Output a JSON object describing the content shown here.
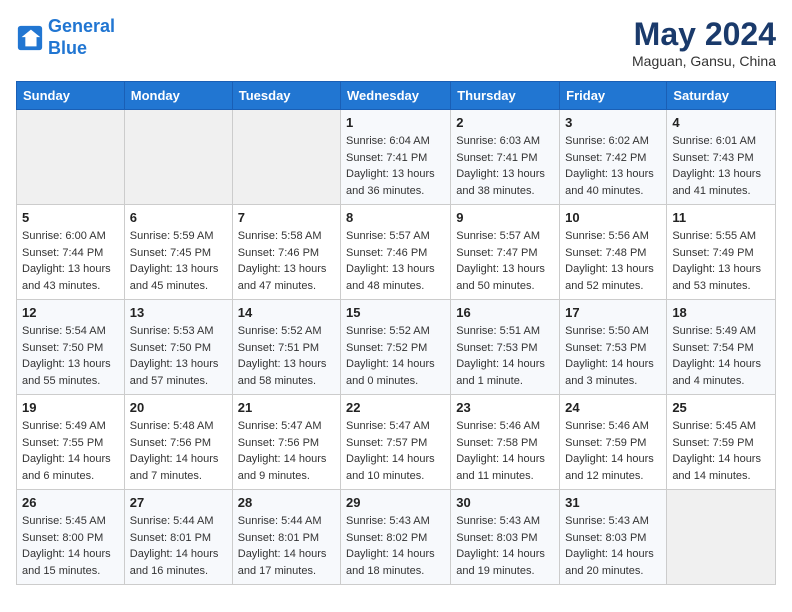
{
  "header": {
    "logo_line1": "General",
    "logo_line2": "Blue",
    "month": "May 2024",
    "location": "Maguan, Gansu, China"
  },
  "weekdays": [
    "Sunday",
    "Monday",
    "Tuesday",
    "Wednesday",
    "Thursday",
    "Friday",
    "Saturday"
  ],
  "weeks": [
    [
      {
        "day": "",
        "info": ""
      },
      {
        "day": "",
        "info": ""
      },
      {
        "day": "",
        "info": ""
      },
      {
        "day": "1",
        "info": "Sunrise: 6:04 AM\nSunset: 7:41 PM\nDaylight: 13 hours and 36 minutes."
      },
      {
        "day": "2",
        "info": "Sunrise: 6:03 AM\nSunset: 7:41 PM\nDaylight: 13 hours and 38 minutes."
      },
      {
        "day": "3",
        "info": "Sunrise: 6:02 AM\nSunset: 7:42 PM\nDaylight: 13 hours and 40 minutes."
      },
      {
        "day": "4",
        "info": "Sunrise: 6:01 AM\nSunset: 7:43 PM\nDaylight: 13 hours and 41 minutes."
      }
    ],
    [
      {
        "day": "5",
        "info": "Sunrise: 6:00 AM\nSunset: 7:44 PM\nDaylight: 13 hours and 43 minutes."
      },
      {
        "day": "6",
        "info": "Sunrise: 5:59 AM\nSunset: 7:45 PM\nDaylight: 13 hours and 45 minutes."
      },
      {
        "day": "7",
        "info": "Sunrise: 5:58 AM\nSunset: 7:46 PM\nDaylight: 13 hours and 47 minutes."
      },
      {
        "day": "8",
        "info": "Sunrise: 5:57 AM\nSunset: 7:46 PM\nDaylight: 13 hours and 48 minutes."
      },
      {
        "day": "9",
        "info": "Sunrise: 5:57 AM\nSunset: 7:47 PM\nDaylight: 13 hours and 50 minutes."
      },
      {
        "day": "10",
        "info": "Sunrise: 5:56 AM\nSunset: 7:48 PM\nDaylight: 13 hours and 52 minutes."
      },
      {
        "day": "11",
        "info": "Sunrise: 5:55 AM\nSunset: 7:49 PM\nDaylight: 13 hours and 53 minutes."
      }
    ],
    [
      {
        "day": "12",
        "info": "Sunrise: 5:54 AM\nSunset: 7:50 PM\nDaylight: 13 hours and 55 minutes."
      },
      {
        "day": "13",
        "info": "Sunrise: 5:53 AM\nSunset: 7:50 PM\nDaylight: 13 hours and 57 minutes."
      },
      {
        "day": "14",
        "info": "Sunrise: 5:52 AM\nSunset: 7:51 PM\nDaylight: 13 hours and 58 minutes."
      },
      {
        "day": "15",
        "info": "Sunrise: 5:52 AM\nSunset: 7:52 PM\nDaylight: 14 hours and 0 minutes."
      },
      {
        "day": "16",
        "info": "Sunrise: 5:51 AM\nSunset: 7:53 PM\nDaylight: 14 hours and 1 minute."
      },
      {
        "day": "17",
        "info": "Sunrise: 5:50 AM\nSunset: 7:53 PM\nDaylight: 14 hours and 3 minutes."
      },
      {
        "day": "18",
        "info": "Sunrise: 5:49 AM\nSunset: 7:54 PM\nDaylight: 14 hours and 4 minutes."
      }
    ],
    [
      {
        "day": "19",
        "info": "Sunrise: 5:49 AM\nSunset: 7:55 PM\nDaylight: 14 hours and 6 minutes."
      },
      {
        "day": "20",
        "info": "Sunrise: 5:48 AM\nSunset: 7:56 PM\nDaylight: 14 hours and 7 minutes."
      },
      {
        "day": "21",
        "info": "Sunrise: 5:47 AM\nSunset: 7:56 PM\nDaylight: 14 hours and 9 minutes."
      },
      {
        "day": "22",
        "info": "Sunrise: 5:47 AM\nSunset: 7:57 PM\nDaylight: 14 hours and 10 minutes."
      },
      {
        "day": "23",
        "info": "Sunrise: 5:46 AM\nSunset: 7:58 PM\nDaylight: 14 hours and 11 minutes."
      },
      {
        "day": "24",
        "info": "Sunrise: 5:46 AM\nSunset: 7:59 PM\nDaylight: 14 hours and 12 minutes."
      },
      {
        "day": "25",
        "info": "Sunrise: 5:45 AM\nSunset: 7:59 PM\nDaylight: 14 hours and 14 minutes."
      }
    ],
    [
      {
        "day": "26",
        "info": "Sunrise: 5:45 AM\nSunset: 8:00 PM\nDaylight: 14 hours and 15 minutes."
      },
      {
        "day": "27",
        "info": "Sunrise: 5:44 AM\nSunset: 8:01 PM\nDaylight: 14 hours and 16 minutes."
      },
      {
        "day": "28",
        "info": "Sunrise: 5:44 AM\nSunset: 8:01 PM\nDaylight: 14 hours and 17 minutes."
      },
      {
        "day": "29",
        "info": "Sunrise: 5:43 AM\nSunset: 8:02 PM\nDaylight: 14 hours and 18 minutes."
      },
      {
        "day": "30",
        "info": "Sunrise: 5:43 AM\nSunset: 8:03 PM\nDaylight: 14 hours and 19 minutes."
      },
      {
        "day": "31",
        "info": "Sunrise: 5:43 AM\nSunset: 8:03 PM\nDaylight: 14 hours and 20 minutes."
      },
      {
        "day": "",
        "info": ""
      }
    ]
  ]
}
